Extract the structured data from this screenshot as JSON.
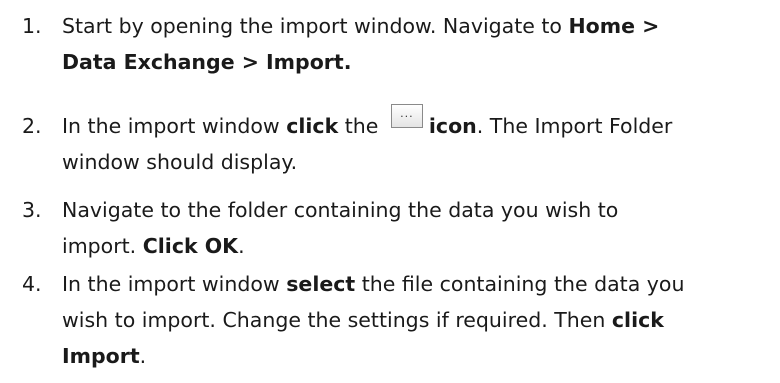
{
  "steps": [
    {
      "number": "1.",
      "line1_a": "Start by opening the import window. Navigate to ",
      "line1_b": "Home >",
      "line2_b": "Data Exchange > Import."
    },
    {
      "number": "2.",
      "line1_a": "In the import window ",
      "line1_b": "click",
      "line1_c": " the ",
      "button_glyph": "...",
      "line1_d": "icon",
      "line1_e": ". The Import Folder",
      "line2_a": "window should display."
    },
    {
      "number": "3.",
      "line1_a": "Navigate to the folder containing the data you wish to",
      "line2_a": "import. ",
      "line2_b": "Click OK",
      "line2_c": "."
    },
    {
      "number": "4.",
      "line1_a": "In the import window ",
      "line1_b": "select",
      "line1_c": " the file containing the data you",
      "line2_a": "wish to import. Change the settings if required. Then ",
      "line2_b": "click",
      "line3_b": "Import",
      "line3_c": "."
    }
  ]
}
